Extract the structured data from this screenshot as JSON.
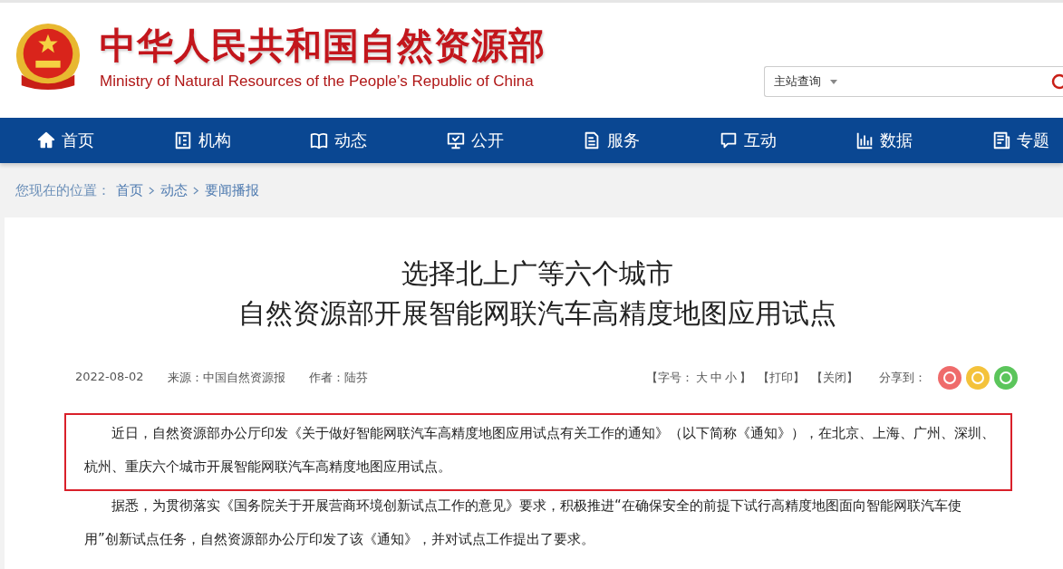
{
  "header": {
    "title": "中华人民共和国自然资源部",
    "subtitle": "Ministry of Natural Resources of the People’s Republic of China",
    "search": {
      "scope": "主站查询"
    }
  },
  "nav": [
    {
      "label": "首页"
    },
    {
      "label": "机构"
    },
    {
      "label": "动态"
    },
    {
      "label": "公开"
    },
    {
      "label": "服务"
    },
    {
      "label": "互动"
    },
    {
      "label": "数据"
    },
    {
      "label": "专题"
    }
  ],
  "breadcrumb": {
    "prefix": "您现在的位置：",
    "items": [
      "首页",
      "动态",
      "要闻播报"
    ]
  },
  "article": {
    "title_lines": [
      "选择北上广等六个城市",
      "自然资源部开展智能网联汽车高精度地图应用试点"
    ],
    "date": "2022-08-02",
    "source": "来源：中国自然资源报",
    "author": "作者：陆芬",
    "tools": [
      "【字号：",
      "大",
      "中",
      "小",
      "】",
      "【打印】",
      "【关闭】"
    ],
    "share_label": "分享到：",
    "share": [
      {
        "color": "#ef6b6b"
      },
      {
        "color": "#f4c23b"
      },
      {
        "color": "#5bc55b"
      }
    ],
    "paragraphs": [
      {
        "text": "近日，自然资源部办公厅印发《关于做好智能网联汽车高精度地图应用试点有关工作的通知》（以下简称《通知》），在北京、上海、广州、深圳、杭州、重庆六个城市开展智能网联汽车高精度地图应用试点。",
        "highlighted": true
      },
      {
        "text": "据悉，为贯彻落实《国务院关于开展营商环境创新试点工作的意见》要求，积极推进“在确保安全的前提下试行高精度地图面向智能网联汽车使用”创新试点任务，自然资源部办公厅印发了该《通知》，并对试点工作提出了要求。",
        "highlighted": false
      }
    ]
  }
}
